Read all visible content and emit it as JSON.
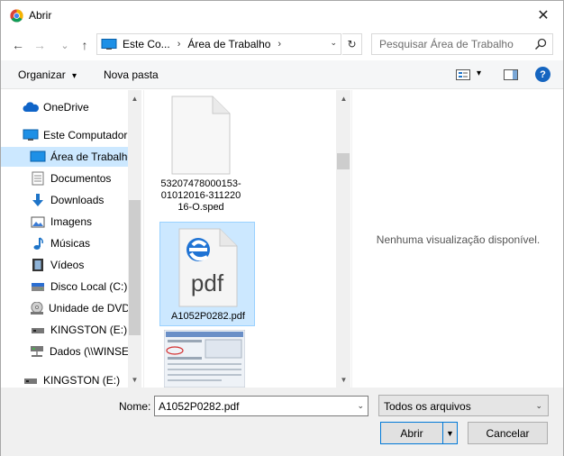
{
  "window": {
    "title": "Abrir",
    "close_glyph": "✕"
  },
  "nav": {
    "back": "←",
    "forward": "→",
    "recent": "⌄",
    "up": "↑",
    "breadcrumb": [
      "Este Co...",
      "Área de Trabalho"
    ],
    "crumb_sep": "›",
    "address_dropdown": "⌄",
    "refresh": "↻",
    "search_placeholder": "Pesquisar Área de Trabalho"
  },
  "toolbar": {
    "organize": "Organizar",
    "organize_arrow": "▾",
    "new_folder": "Nova pasta",
    "view_arrow": "▾",
    "help": "?"
  },
  "sidebar": {
    "items": [
      {
        "label": "OneDrive",
        "icon": "onedrive-icon"
      },
      {
        "label": "Este Computador",
        "icon": "computer-icon"
      },
      {
        "label": "Área de Trabalho",
        "icon": "desktop-icon",
        "selected": true
      },
      {
        "label": "Documentos",
        "icon": "documents-icon"
      },
      {
        "label": "Downloads",
        "icon": "downloads-icon"
      },
      {
        "label": "Imagens",
        "icon": "pictures-icon"
      },
      {
        "label": "Músicas",
        "icon": "music-icon"
      },
      {
        "label": "Vídeos",
        "icon": "videos-icon"
      },
      {
        "label": "Disco Local (C:)",
        "icon": "local-disk-icon"
      },
      {
        "label": "Unidade de DVD",
        "icon": "dvd-drive-icon"
      },
      {
        "label": "KINGSTON (E:)",
        "icon": "usb-drive-icon"
      },
      {
        "label": "Dados (\\\\WINSE",
        "icon": "network-drive-icon"
      },
      {
        "label": "KINGSTON (E:)",
        "icon": "usb-drive-icon"
      }
    ]
  },
  "files": [
    {
      "name_lines": [
        "53207478000153-",
        "01012016-311220",
        "16-O.sped"
      ],
      "icon": "blank-file-icon"
    },
    {
      "name_lines": [
        "A1052P0282.pdf"
      ],
      "icon": "edge-pdf-icon",
      "icon_text": "pdf",
      "selected": true
    },
    {
      "name_lines": [],
      "icon": "screenshot-thumbnail"
    }
  ],
  "preview": {
    "message": "Nenhuma visualização disponível."
  },
  "bottom": {
    "name_label": "Nome:",
    "name_value": "A1052P0282.pdf",
    "filter_value": "Todos os arquivos",
    "open_label": "Abrir",
    "cancel_label": "Cancelar"
  },
  "colors": {
    "selection": "#cce8ff",
    "selection_border": "#99d1ff",
    "accent": "#0078d7"
  }
}
